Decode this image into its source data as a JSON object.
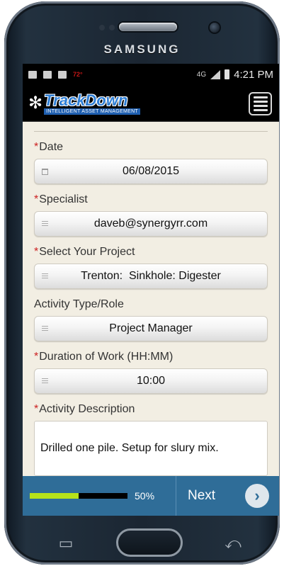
{
  "device": {
    "brand": "SAMSUNG"
  },
  "status_bar": {
    "temperature": "72°",
    "network": "4G",
    "time": "4:21 PM"
  },
  "app": {
    "logo_title": "TrackDown",
    "logo_tagline": "INTELLIGENT ASSET MANAGEMENT"
  },
  "form": {
    "date": {
      "label": "Date",
      "required": "*",
      "value": "06/08/2015"
    },
    "specialist": {
      "label": "Specialist",
      "required": "*",
      "value": "daveb@synergyrr.com"
    },
    "project": {
      "label": "Select Your Project",
      "required": "*",
      "value": "Trenton:  Sinkhole: Digester"
    },
    "activity_type": {
      "label": "Activity Type/Role",
      "value": "Project Manager"
    },
    "duration": {
      "label": "Duration of Work (HH:MM)",
      "required": "*",
      "value": "10:00"
    },
    "description": {
      "label": "Activity Description",
      "required": "*",
      "value": "Drilled one pile. Setup for slury mix."
    }
  },
  "footer": {
    "progress_percent": 50,
    "progress_text": "50%",
    "next_label": "Next"
  },
  "colors": {
    "accent_blue": "#2f6d98",
    "progress_fill": "#b7e21a",
    "required_red": "#cc2222"
  }
}
